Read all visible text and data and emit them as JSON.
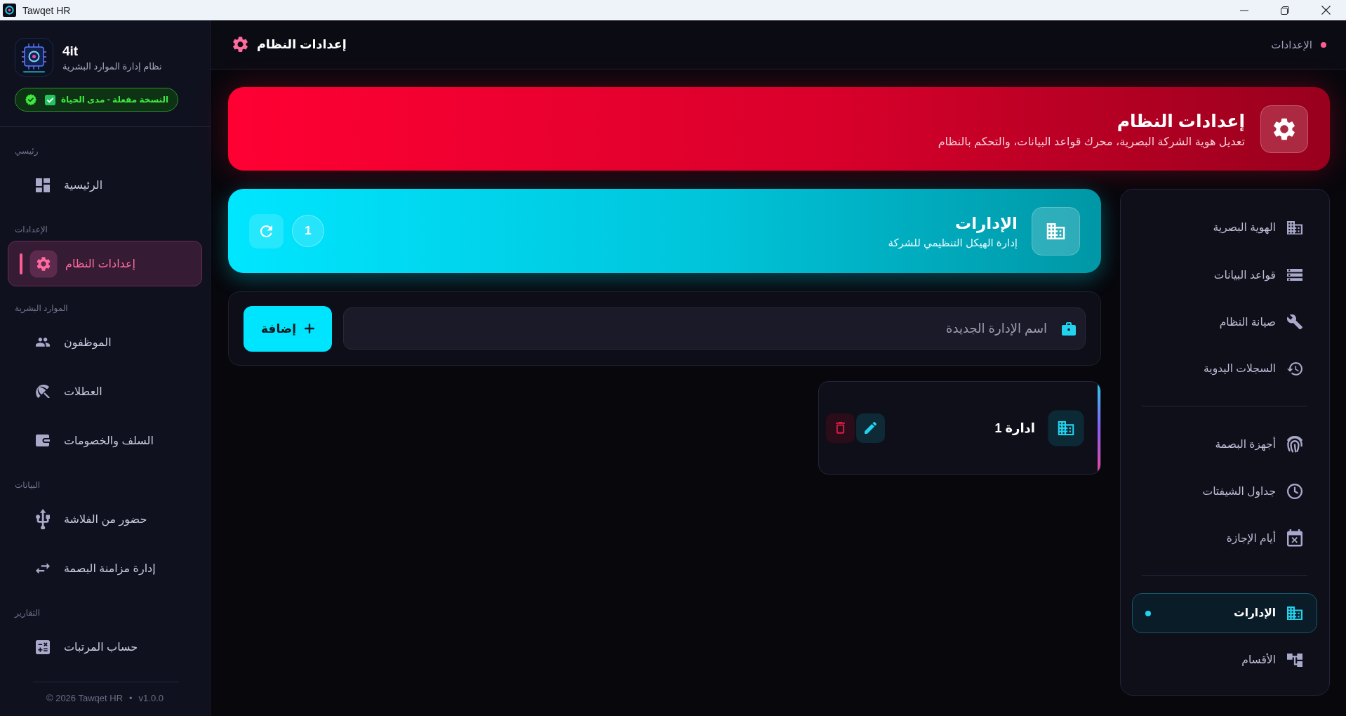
{
  "window": {
    "title": "Tawqet HR"
  },
  "sidebar": {
    "brand": {
      "name": "4it",
      "subtitle": "نظام إدارة الموارد البشرية"
    },
    "license": {
      "label": "النسخة مفعلة - مدى الحياة",
      "checked": true
    },
    "sections": [
      {
        "title": "رئيسي",
        "items": [
          {
            "label": "الرئيسية",
            "selected": false
          }
        ]
      },
      {
        "title": "الإعدادات",
        "items": [
          {
            "label": "إعدادات النظام",
            "selected": true
          }
        ]
      },
      {
        "title": "الموارد البشرية",
        "items": [
          {
            "label": "الموظفون",
            "selected": false
          },
          {
            "label": "العطلات",
            "selected": false
          },
          {
            "label": "السلف والخصومات",
            "selected": false
          }
        ]
      },
      {
        "title": "البيانات",
        "items": [
          {
            "label": "حضور من الفلاشة",
            "selected": false
          },
          {
            "label": "إدارة مزامنة البصمة",
            "selected": false
          }
        ]
      },
      {
        "title": "التقارير",
        "items": [
          {
            "label": "حساب المرتبات",
            "selected": false
          }
        ]
      }
    ],
    "footer": {
      "copyright": "© 2026 Tawqet HR",
      "separator": "•",
      "version": "v1.0.0"
    }
  },
  "header": {
    "title": "إعدادات النظام",
    "breadcrumb": "الإعدادات"
  },
  "banner": {
    "title": "إعدادات النظام",
    "subtitle": "تعديل هوية الشركة البصرية، محرك قواعد البيانات، والتحكم بالنظام"
  },
  "departments": {
    "title": "الإدارات",
    "subtitle": "إدارة الهيكل التنظيمي للشركة",
    "count": "1",
    "form": {
      "placeholder": "اسم الإدارة الجديدة",
      "button": "إضافة"
    },
    "items": [
      {
        "name": "ادارة 1"
      }
    ]
  },
  "settings_nav": {
    "groups": [
      {
        "items": [
          {
            "label": "الهوية البصرية",
            "selected": false
          },
          {
            "label": "قواعد البيانات",
            "selected": false
          },
          {
            "label": "صيانة النظام",
            "selected": false
          },
          {
            "label": "السجلات اليدوية",
            "selected": false
          }
        ]
      },
      {
        "items": [
          {
            "label": "أجهزة البصمة",
            "selected": false
          },
          {
            "label": "جداول الشيفتات",
            "selected": false
          },
          {
            "label": "أيام الإجازة",
            "selected": false
          }
        ]
      },
      {
        "items": [
          {
            "label": "الإدارات",
            "selected": true
          },
          {
            "label": "الأقسام",
            "selected": false
          }
        ]
      }
    ]
  }
}
